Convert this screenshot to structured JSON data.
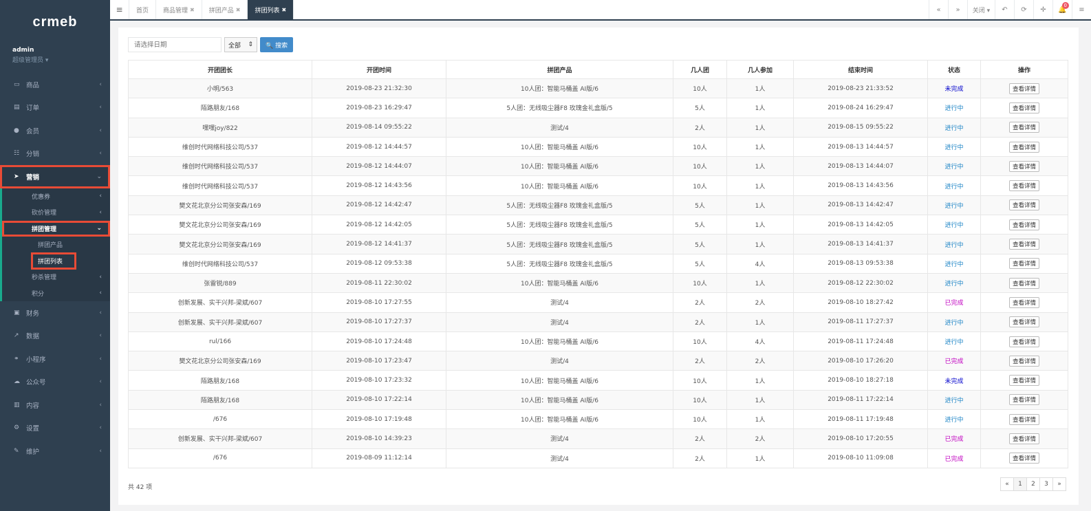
{
  "app": {
    "logo": "crmeb"
  },
  "user": {
    "name": "admin",
    "role": "超级管理员 ▾"
  },
  "nav": {
    "items_top": [
      {
        "icon": "▭",
        "icon_name": "desktop-icon",
        "label": "商品"
      },
      {
        "icon": "▤",
        "icon_name": "order-icon",
        "label": "订单"
      },
      {
        "icon": "●",
        "icon_name": "user-icon",
        "label": "会员"
      },
      {
        "icon": "☷",
        "icon_name": "users-icon",
        "label": "分销"
      }
    ],
    "marketing": {
      "icon": "➤",
      "icon_name": "paper-plane-icon",
      "label": "营销"
    },
    "marketing_sub": [
      {
        "label": "优惠券"
      },
      {
        "label": "砍价管理"
      }
    ],
    "group_mgmt": {
      "label": "拼团管理"
    },
    "group_sub": [
      {
        "label": "拼团产品"
      },
      {
        "label": "拼团列表"
      }
    ],
    "marketing_sub_after": [
      {
        "label": "秒杀管理"
      },
      {
        "label": "积分"
      }
    ],
    "items_bottom": [
      {
        "icon": "▣",
        "icon_name": "money-icon",
        "label": "财务"
      },
      {
        "icon": "↗",
        "icon_name": "chart-icon",
        "label": "数据"
      },
      {
        "icon": "⚭",
        "icon_name": "link-icon",
        "label": "小程序"
      },
      {
        "icon": "☁",
        "icon_name": "wechat-icon",
        "label": "公众号"
      },
      {
        "icon": "▥",
        "icon_name": "content-icon",
        "label": "内容"
      },
      {
        "icon": "⚙",
        "icon_name": "gear-icon",
        "label": "设置"
      },
      {
        "icon": "✎",
        "icon_name": "wrench-icon",
        "label": "维护"
      }
    ],
    "chev": "‹",
    "chev_open": "⌄"
  },
  "tabs": [
    {
      "label": "首页",
      "closable": false
    },
    {
      "label": "商品管理",
      "closable": true
    },
    {
      "label": "拼团产品",
      "closable": true
    },
    {
      "label": "拼团列表",
      "closable": true
    }
  ],
  "toolbar": {
    "close_label": "关闭 ▾",
    "notify_count": "0"
  },
  "filters": {
    "date_placeholder": "请选择日期",
    "status_selected": "全部",
    "search_label": "🔍 搜索"
  },
  "table": {
    "headers": [
      "开团团长",
      "开团时间",
      "拼团产品",
      "几人团",
      "几人参加",
      "结束时间",
      "状态",
      "操作"
    ],
    "detail_label": "查看详情",
    "rows": [
      [
        "小明/563",
        "2019-08-23 21:32:30",
        "10人团：智能马桶盖 AI版/6",
        "10人",
        "1人",
        "2019-08-23 21:33:52",
        "未完成"
      ],
      [
        "陌路朋友/168",
        "2019-08-23 16:29:47",
        "5人团：无线吸尘器F8 玫瑰金礼盒版/5",
        "5人",
        "1人",
        "2019-08-24 16:29:47",
        "进行中"
      ],
      [
        "嘿嘿joy/822",
        "2019-08-14 09:55:22",
        "测试/4",
        "2人",
        "1人",
        "2019-08-15 09:55:22",
        "进行中"
      ],
      [
        "维创时代网络科技公司/537",
        "2019-08-12 14:44:57",
        "10人团：智能马桶盖 AI版/6",
        "10人",
        "1人",
        "2019-08-13 14:44:57",
        "进行中"
      ],
      [
        "维创时代网络科技公司/537",
        "2019-08-12 14:44:07",
        "10人团：智能马桶盖 AI版/6",
        "10人",
        "1人",
        "2019-08-13 14:44:07",
        "进行中"
      ],
      [
        "维创时代网络科技公司/537",
        "2019-08-12 14:43:56",
        "10人团：智能马桶盖 AI版/6",
        "10人",
        "1人",
        "2019-08-13 14:43:56",
        "进行中"
      ],
      [
        "樊文花北京分公司张安森/169",
        "2019-08-12 14:42:47",
        "5人团：无线吸尘器F8 玫瑰金礼盒版/5",
        "5人",
        "1人",
        "2019-08-13 14:42:47",
        "进行中"
      ],
      [
        "樊文花北京分公司张安森/169",
        "2019-08-12 14:42:05",
        "5人团：无线吸尘器F8 玫瑰金礼盒版/5",
        "5人",
        "1人",
        "2019-08-13 14:42:05",
        "进行中"
      ],
      [
        "樊文花北京分公司张安森/169",
        "2019-08-12 14:41:37",
        "5人团：无线吸尘器F8 玫瑰金礼盒版/5",
        "5人",
        "1人",
        "2019-08-13 14:41:37",
        "进行中"
      ],
      [
        "维创时代网络科技公司/537",
        "2019-08-12 09:53:38",
        "5人团：无线吸尘器F8 玫瑰金礼盒版/5",
        "5人",
        "4人",
        "2019-08-13 09:53:38",
        "进行中"
      ],
      [
        "张雷锐/889",
        "2019-08-11 22:30:02",
        "10人团：智能马桶盖 AI版/6",
        "10人",
        "1人",
        "2019-08-12 22:30:02",
        "进行中"
      ],
      [
        "创新发展、实干兴邦-梁斌/607",
        "2019-08-10 17:27:55",
        "测试/4",
        "2人",
        "2人",
        "2019-08-10 18:27:42",
        "已完成"
      ],
      [
        "创新发展、实干兴邦-梁斌/607",
        "2019-08-10 17:27:37",
        "测试/4",
        "2人",
        "1人",
        "2019-08-11 17:27:37",
        "进行中"
      ],
      [
        "rul/166",
        "2019-08-10 17:24:48",
        "10人团：智能马桶盖 AI版/6",
        "10人",
        "4人",
        "2019-08-11 17:24:48",
        "进行中"
      ],
      [
        "樊文花北京分公司张安森/169",
        "2019-08-10 17:23:47",
        "测试/4",
        "2人",
        "2人",
        "2019-08-10 17:26:20",
        "已完成"
      ],
      [
        "陌路朋友/168",
        "2019-08-10 17:23:32",
        "10人团：智能马桶盖 AI版/6",
        "10人",
        "1人",
        "2019-08-10 18:27:18",
        "未完成"
      ],
      [
        "陌路朋友/168",
        "2019-08-10 17:22:14",
        "10人团：智能马桶盖 AI版/6",
        "10人",
        "1人",
        "2019-08-11 17:22:14",
        "进行中"
      ],
      [
        "/676",
        "2019-08-10 17:19:48",
        "10人团：智能马桶盖 AI版/6",
        "10人",
        "1人",
        "2019-08-11 17:19:48",
        "进行中"
      ],
      [
        "创新发展、实干兴邦-梁斌/607",
        "2019-08-10 14:39:23",
        "测试/4",
        "2人",
        "2人",
        "2019-08-10 17:20:55",
        "已完成"
      ],
      [
        "/676",
        "2019-08-09 11:12:14",
        "测试/4",
        "2人",
        "1人",
        "2019-08-10 11:09:08",
        "已完成"
      ]
    ]
  },
  "footer": {
    "total": "共 42 项",
    "pages": [
      "«",
      "1",
      "2",
      "3",
      "»"
    ]
  },
  "colors": {
    "sidebar": "#2f4050",
    "accent": "#19aa8d",
    "highlight": "#e84b36",
    "in_progress": "#1c84c6",
    "not_done": "#0000cc",
    "done": "#c000c0",
    "search_btn": "#428bca"
  }
}
